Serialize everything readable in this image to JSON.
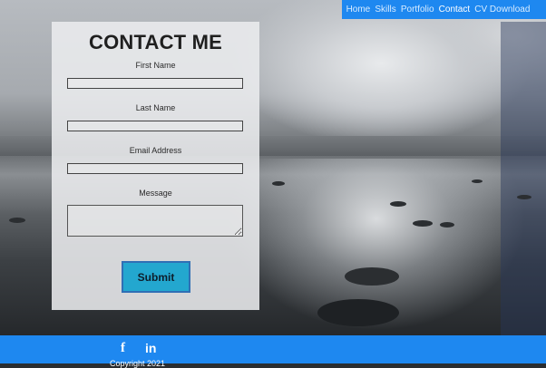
{
  "nav": {
    "items": [
      {
        "label": "Home"
      },
      {
        "label": "Skills"
      },
      {
        "label": "Portfolio"
      },
      {
        "label": "Contact"
      },
      {
        "label": "CV Download"
      }
    ],
    "active": "Contact"
  },
  "form": {
    "title": "CONTACT ME",
    "first_name_label": "First Name",
    "last_name_label": "Last Name",
    "email_label": "Email Address",
    "message_label": "Message",
    "submit_label": "Submit"
  },
  "footer": {
    "facebook_glyph": "f",
    "linkedin_glyph": "in",
    "copyright": "Copyright 2021"
  },
  "colors": {
    "nav_bg": "#1e88f0",
    "button_bg": "#23a7cf",
    "footer_bg": "#1e88f0"
  }
}
